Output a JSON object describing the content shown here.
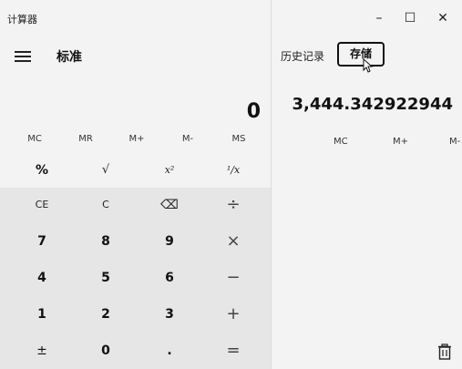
{
  "window": {
    "title": "计算器",
    "minimize_label": "–",
    "maximize_label": "☐",
    "close_label": "✕"
  },
  "header": {
    "menu_icon": "hamburger-icon",
    "mode": "标准"
  },
  "display": {
    "value": "0"
  },
  "memory_bar": [
    "MC",
    "MR",
    "M+",
    "M-",
    "MS"
  ],
  "function_row": [
    "%",
    "√",
    "x²",
    "¹/x"
  ],
  "keypad": [
    [
      "CE",
      "C",
      "⌫",
      "÷"
    ],
    [
      "7",
      "8",
      "9",
      "×"
    ],
    [
      "4",
      "5",
      "6",
      "−"
    ],
    [
      "1",
      "2",
      "3",
      "+"
    ],
    [
      "±",
      "0",
      ".",
      "="
    ]
  ],
  "side_panel": {
    "tabs": {
      "history": "历史记录",
      "memory": "存储"
    },
    "memory_value": "3,444.342922944",
    "memory_ops": [
      "MC",
      "M+",
      "M-"
    ],
    "delete_icon": "trash-icon"
  }
}
